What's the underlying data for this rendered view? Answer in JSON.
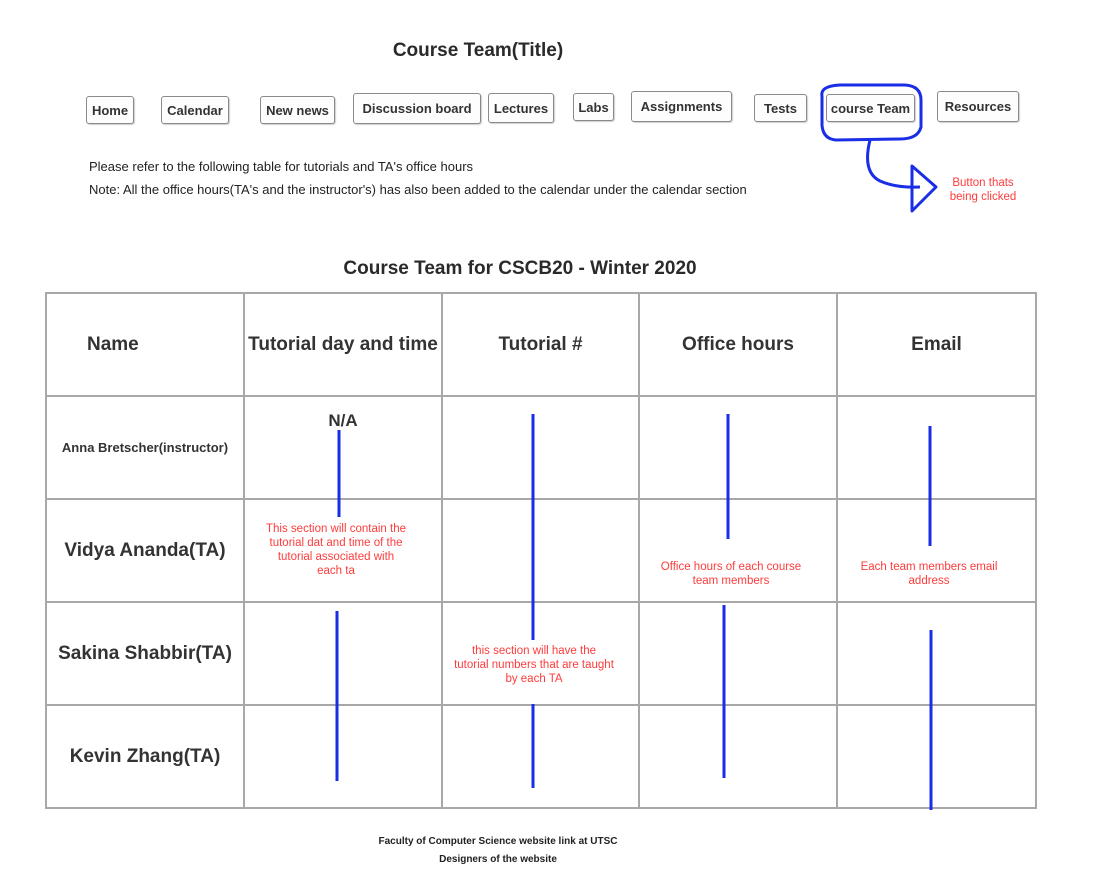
{
  "page_title": "Course Team(Title)",
  "nav": {
    "items": [
      {
        "id": "home",
        "label": "Home"
      },
      {
        "id": "calendar",
        "label": "Calendar"
      },
      {
        "id": "new-news",
        "label": "New news"
      },
      {
        "id": "discussion-board",
        "label": "Discussion board"
      },
      {
        "id": "lectures",
        "label": "Lectures"
      },
      {
        "id": "labs",
        "label": "Labs"
      },
      {
        "id": "assignments",
        "label": "Assignments"
      },
      {
        "id": "tests",
        "label": "Tests"
      },
      {
        "id": "course-team",
        "label": "course Team"
      },
      {
        "id": "resources",
        "label": "Resources"
      }
    ]
  },
  "intro": {
    "line1": "Please refer to the following table for tutorials and  TA's office hours",
    "line2": "Note: All the office hours(TA's and the instructor's) has also been added to the calendar under the calendar section"
  },
  "annotations": {
    "clicked": "Button thats being clicked",
    "tutorial_day": "This section will contain the tutorial dat and time of the tutorial associated with each ta",
    "tutorial_number": "this section will have the tutorial numbers that are taught by each TA",
    "office_hours": "Office hours of each course team members",
    "email": "Each team members email address",
    "accent_color": "#1a2ee6",
    "note_color": "#ff3b3b"
  },
  "table": {
    "title": "Course Team for CSCB20 - Winter 2020",
    "headers": [
      "Name",
      "Tutorial day and time",
      "Tutorial #",
      "Office hours",
      "Email"
    ],
    "rows": [
      {
        "name": "Anna Bretscher(instructor)",
        "tutorial": "N/A"
      },
      {
        "name": "Vidya Ananda(TA)"
      },
      {
        "name": "Sakina Shabbir(TA)"
      },
      {
        "name": "Kevin Zhang(TA)"
      }
    ]
  },
  "footer": {
    "line1": "Faculty of Computer Science website link at UTSC",
    "line2": "Designers of the website"
  }
}
